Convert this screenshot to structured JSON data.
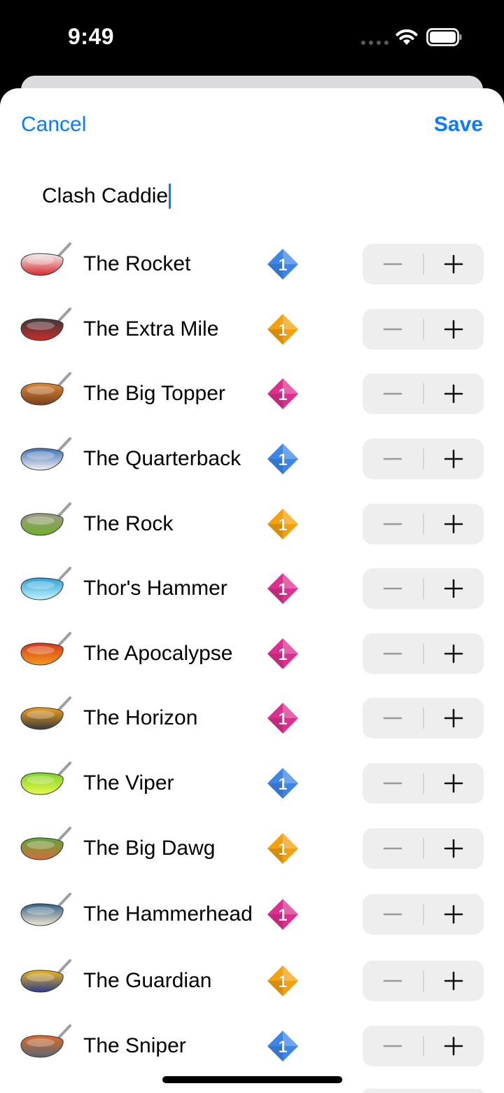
{
  "status": {
    "time": "9:49"
  },
  "nav": {
    "cancel_label": "Cancel",
    "save_label": "Save"
  },
  "caddie": {
    "name": "Clash Caddie"
  },
  "clubs": [
    {
      "name": "The Rocket",
      "rarity": "blue",
      "level": "1",
      "icon": "driver-rocket-icon",
      "colors": [
        "#f2f2f2",
        "#d8272b"
      ]
    },
    {
      "name": "The Extra Mile",
      "rarity": "gold",
      "level": "1",
      "icon": "driver-extra-mile-icon",
      "colors": [
        "#3a3a3a",
        "#cc2a2a"
      ]
    },
    {
      "name": "The Big Topper",
      "rarity": "pink",
      "level": "1",
      "icon": "driver-big-topper-icon",
      "colors": [
        "#d98a3a",
        "#7a3f1c"
      ]
    },
    {
      "name": "The Quarterback",
      "rarity": "blue",
      "level": "1",
      "icon": "driver-quarterback-icon",
      "colors": [
        "#3e6fb6",
        "#f0f0f0"
      ]
    },
    {
      "name": "The Rock",
      "rarity": "gold",
      "level": "1",
      "icon": "driver-rock-icon",
      "colors": [
        "#9c9a86",
        "#6fae2a"
      ]
    },
    {
      "name": "Thor's Hammer",
      "rarity": "pink",
      "level": "1",
      "icon": "driver-thors-hammer-icon",
      "colors": [
        "#2d9fd4",
        "#bff3ff"
      ]
    },
    {
      "name": "The Apocalypse",
      "rarity": "pink",
      "level": "1",
      "icon": "driver-apocalypse-icon",
      "colors": [
        "#d4361a",
        "#f59b1e"
      ]
    },
    {
      "name": "The Horizon",
      "rarity": "pink",
      "level": "1",
      "icon": "driver-horizon-icon",
      "colors": [
        "#f2a11d",
        "#3a3a3a"
      ]
    },
    {
      "name": "The Viper",
      "rarity": "blue",
      "level": "1",
      "icon": "driver-viper-icon",
      "colors": [
        "#7fd12a",
        "#e5f94a"
      ]
    },
    {
      "name": "The Big Dawg",
      "rarity": "gold",
      "level": "1",
      "icon": "driver-big-dawg-icon",
      "colors": [
        "#5fa83a",
        "#d36b3a"
      ]
    },
    {
      "name": "The Hammerhead",
      "rarity": "pink",
      "level": "1",
      "icon": "driver-hammerhead-icon",
      "colors": [
        "#2e5e86",
        "#efe7cf"
      ]
    },
    {
      "name": "The Guardian",
      "rarity": "gold",
      "level": "1",
      "icon": "driver-guardian-icon",
      "colors": [
        "#f0b81c",
        "#2b3b8f"
      ]
    },
    {
      "name": "The Sniper",
      "rarity": "blue",
      "level": "1",
      "icon": "driver-sniper-icon",
      "colors": [
        "#e06a2a",
        "#5a6673"
      ]
    }
  ],
  "stepper": {
    "minus_icon": "minus-icon",
    "plus_icon": "plus-icon"
  },
  "theme": {
    "accent": "#0a7aff",
    "gem_blue": "#3d86e8",
    "gem_gold": "#f5a10e",
    "gem_pink": "#dc2f8f"
  }
}
